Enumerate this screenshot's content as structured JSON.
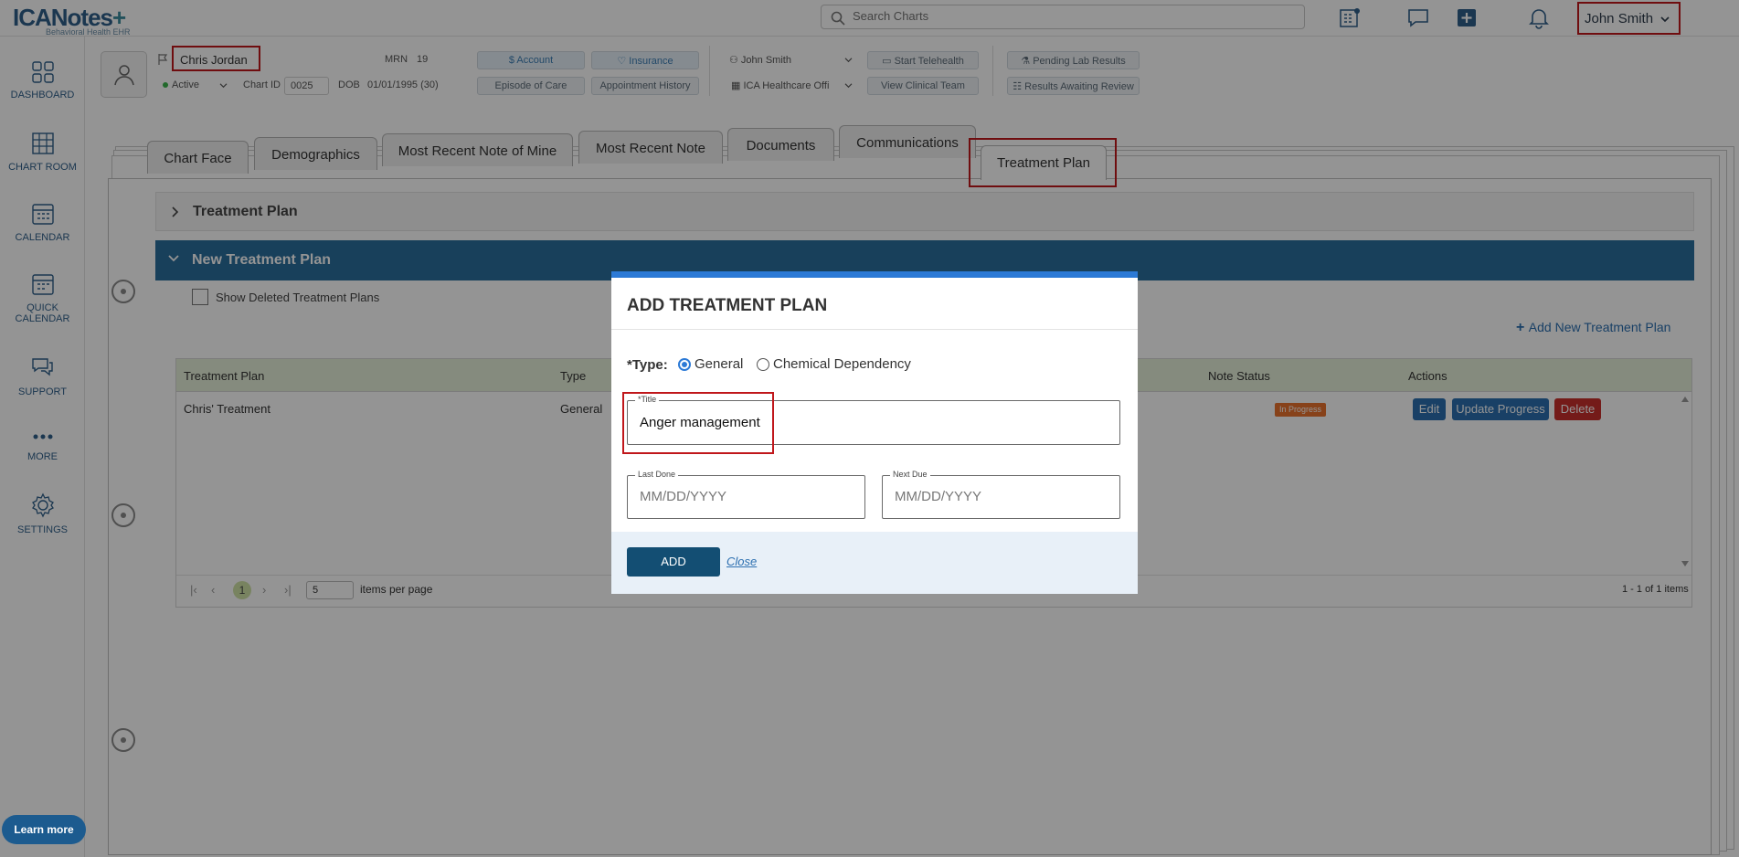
{
  "app": {
    "brand": "ICANotes",
    "brand_plus": "+",
    "subtitle": "Behavioral Health EHR"
  },
  "search": {
    "placeholder": "Search Charts"
  },
  "user": {
    "name": "John Smith"
  },
  "sidebar": {
    "items": [
      {
        "label": "DASHBOARD",
        "icon": "dashboard-icon"
      },
      {
        "label": "CHART ROOM",
        "icon": "chart-room-icon"
      },
      {
        "label": "CALENDAR",
        "icon": "calendar-icon"
      },
      {
        "label_line1": "QUICK",
        "label_line2": "CALENDAR",
        "icon": "quick-calendar-icon"
      },
      {
        "label": "SUPPORT",
        "icon": "support-icon"
      },
      {
        "label": "MORE",
        "icon": "more-icon"
      },
      {
        "label": "SETTINGS",
        "icon": "gear-icon"
      }
    ],
    "learn_more": "Learn more"
  },
  "patient": {
    "name": "Chris Jordan",
    "mrn_label": "MRN",
    "mrn": "19",
    "status": "Active",
    "chart_id_label": "Chart ID",
    "chart_id": "0025",
    "dob_label": "DOB",
    "dob": "01/01/1995 (30)"
  },
  "header_actions": {
    "account": "Account",
    "insurance": "Insurance",
    "episode_of_care": "Episode of Care",
    "appointment_history": "Appointment History",
    "provider": "John Smith",
    "facility": "ICA Healthcare Offi",
    "start_telehealth": "Start Telehealth",
    "view_clinical_team": "View Clinical Team",
    "pending_lab_results": "Pending Lab Results",
    "results_awaiting_review": "Results Awaiting Review"
  },
  "tabs": [
    "Chart Face",
    "Demographics",
    "Most Recent Note of Mine",
    "Most Recent Note",
    "Documents",
    "Communications",
    "Treatment Plan"
  ],
  "sections": {
    "collapsed": "Treatment Plan",
    "open": "New Treatment Plan"
  },
  "show_deleted": "Show Deleted Treatment Plans",
  "add_new": "Add New Treatment Plan",
  "table": {
    "columns": [
      "Treatment Plan",
      "Type",
      "Note Status",
      "Actions"
    ],
    "rows": [
      {
        "plan": "Chris' Treatment",
        "type": "General",
        "status": "In Progress"
      }
    ],
    "actions": {
      "edit": "Edit",
      "update": "Update Progress",
      "delete": "Delete"
    },
    "pager": {
      "page": "1",
      "per_page": "5",
      "per_page_label": "items per page",
      "summary": "1 - 1 of 1 items"
    }
  },
  "modal": {
    "title": "ADD TREATMENT PLAN",
    "type_label": "*Type:",
    "type_options": [
      "General",
      "Chemical Dependency"
    ],
    "type_selected": "General",
    "title_label": "*Title",
    "title_value": "Anger management",
    "last_done_label": "Last Done",
    "last_done_placeholder": "MM/DD/YYYY",
    "next_due_label": "Next Due",
    "next_due_placeholder": "MM/DD/YYYY",
    "add_button": "ADD",
    "close_link": "Close"
  },
  "colors": {
    "accent": "#2c7ad6",
    "header_blue": "#2a6e9e",
    "highlight": "#c0171b",
    "add_button": "#134e73"
  }
}
